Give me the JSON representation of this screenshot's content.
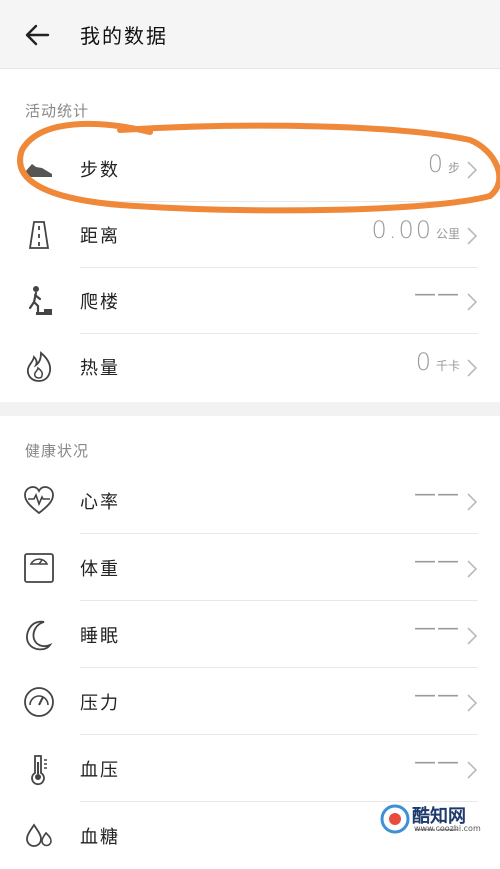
{
  "header": {
    "title": "我的数据"
  },
  "sections": {
    "activity": {
      "label": "活动统计"
    },
    "health": {
      "label": "健康状况"
    }
  },
  "activity_rows": [
    {
      "label": "步数",
      "value": "0",
      "unit": "步"
    },
    {
      "label": "距离",
      "value": "0.00",
      "unit": "公里"
    },
    {
      "label": "爬楼",
      "value": "——",
      "unit": ""
    },
    {
      "label": "热量",
      "value": "0",
      "unit": "千卡"
    }
  ],
  "health_rows": [
    {
      "label": "心率",
      "value": "——"
    },
    {
      "label": "体重",
      "value": "——"
    },
    {
      "label": "睡眠",
      "value": "——"
    },
    {
      "label": "压力",
      "value": "——"
    },
    {
      "label": "血压",
      "value": "——"
    },
    {
      "label": "血糖",
      "value": "——"
    }
  ],
  "watermark": {
    "name": "酷知网",
    "url": "www.coozhi.com"
  },
  "colors": {
    "annotation": "#f0883a",
    "text": "#222222",
    "muted": "#9a9a9a"
  }
}
